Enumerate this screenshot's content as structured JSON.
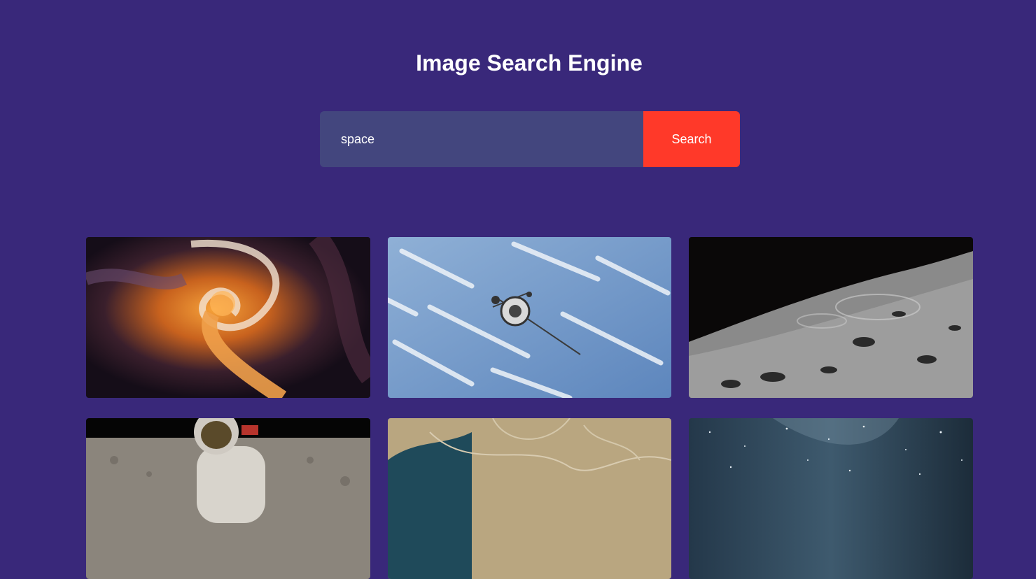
{
  "header": {
    "title": "Image Search Engine"
  },
  "search": {
    "value": "space",
    "button_label": "Search"
  },
  "results": [
    {
      "icon": "nebula-image"
    },
    {
      "icon": "satellite-image"
    },
    {
      "icon": "moon-surface-image"
    },
    {
      "icon": "astronaut-image"
    },
    {
      "icon": "earth-from-orbit-image"
    },
    {
      "icon": "milky-way-image"
    }
  ],
  "colors": {
    "background": "#39287a",
    "input_background": "#43467e",
    "button_background": "#ff3929",
    "text": "#ffffff"
  }
}
